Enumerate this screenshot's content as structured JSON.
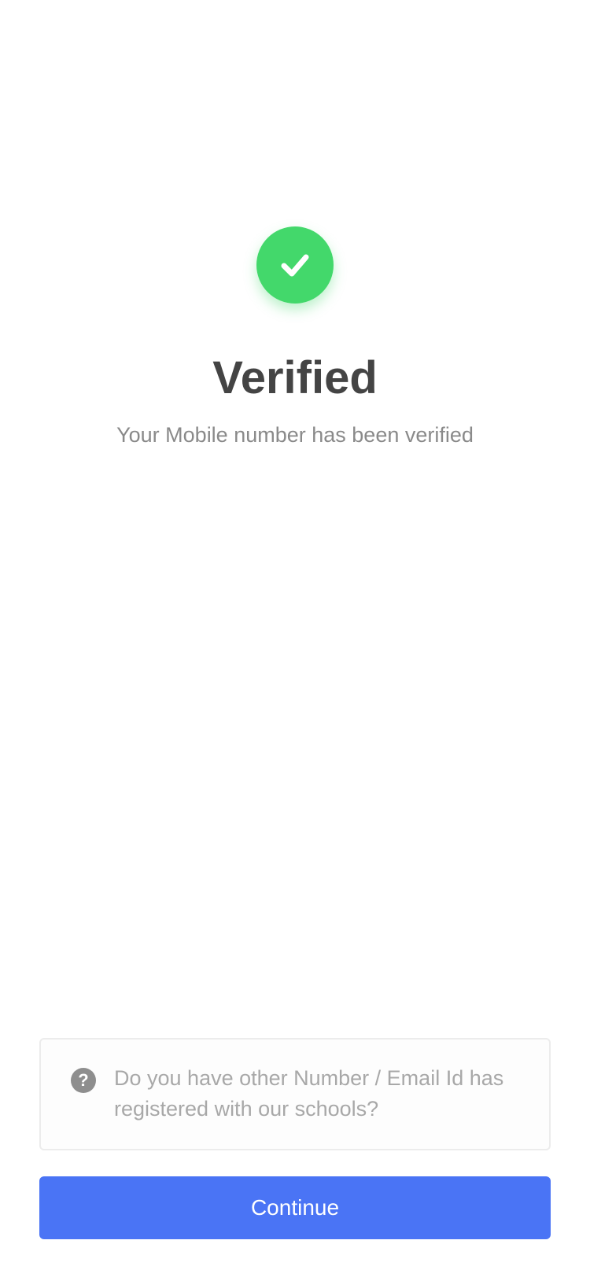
{
  "status": {
    "icon": "check-icon",
    "color": "#43d86b"
  },
  "title": "Verified",
  "subtitle": "Your Mobile number has been verified",
  "help": {
    "icon": "question-icon",
    "text": "Do you have other Number / Email Id has registered with our schools?"
  },
  "actions": {
    "continue_label": "Continue",
    "continue_color": "#4a74f5"
  }
}
